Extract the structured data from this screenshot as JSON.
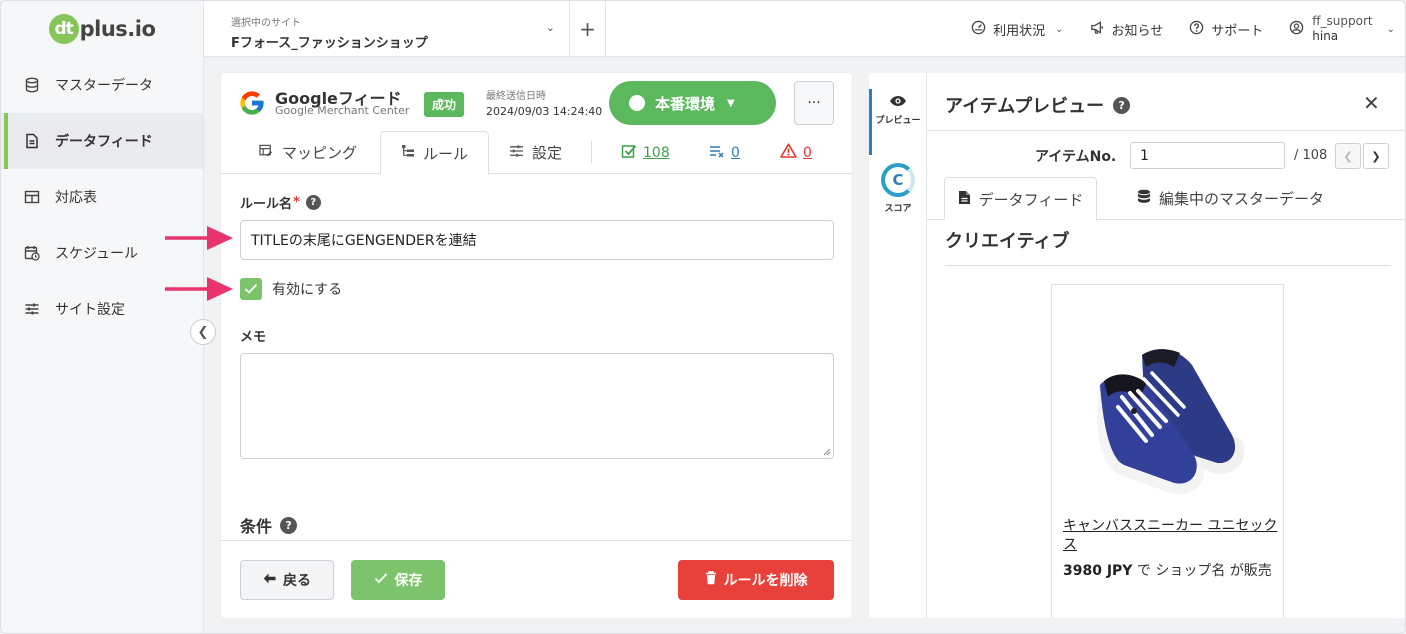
{
  "logo": {
    "mark": "dt",
    "text": "plus.io"
  },
  "sidebar": {
    "items": [
      {
        "label": "マスターデータ",
        "icon": "database-icon",
        "active": false
      },
      {
        "label": "データフィード",
        "icon": "file-icon",
        "active": true
      },
      {
        "label": "対応表",
        "icon": "table-icon",
        "active": false
      },
      {
        "label": "スケジュール",
        "icon": "calendar-clock-icon",
        "active": false
      },
      {
        "label": "サイト設定",
        "icon": "sliders-icon",
        "active": false
      }
    ]
  },
  "topbar": {
    "site_label": "選択中のサイト",
    "site_name": "Fフォース_ファッションショップ",
    "usage": "利用状況",
    "news": "お知らせ",
    "support": "サポート",
    "user_line1": "ff_support",
    "user_line2": "hina"
  },
  "feed": {
    "title": "Googleフィード",
    "subtitle": "Google Merchant Center",
    "status": "成功",
    "last_sent_label": "最終送信日時",
    "last_sent_date": "2024/09/03 14:24:40",
    "env_label": "本番環境",
    "more": "···"
  },
  "tabs": {
    "mapping": "マッピング",
    "rules": "ルール",
    "settings": "設定",
    "count_ok": "108",
    "count_excluded": "0",
    "count_warning": "0"
  },
  "form": {
    "rule_name_label": "ルール名",
    "required_mark": "*",
    "rule_name_value": "TITLEの末尾にGENGENDERを連結",
    "enable_label": "有効にする",
    "enabled": true,
    "memo_label": "メモ",
    "memo_value": "",
    "conditions_label": "条件"
  },
  "footer": {
    "back": "戻る",
    "save": "保存",
    "delete": "ルールを削除"
  },
  "rail": {
    "preview": "プレビュー",
    "score": "スコア",
    "score_letter": "C"
  },
  "preview": {
    "title": "アイテムプレビュー",
    "item_no_label": "アイテムNo.",
    "item_no_value": "1",
    "item_total": "/ 108",
    "tab_feed": "データフィード",
    "tab_master": "編集中のマスターデータ",
    "section": "クリエイティブ",
    "product_name": "キャンバススニーカー ユニセックス",
    "price": "3980 JPY",
    "price_mid": "で",
    "shop": "ショップ名",
    "price_tail": "が販売"
  },
  "colors": {
    "accent_green": "#5cb85c",
    "check_green": "#7cc36c",
    "danger_red": "#e8413c",
    "arrow_pink": "#e8336b",
    "score_blue": "#2c9fc9"
  }
}
